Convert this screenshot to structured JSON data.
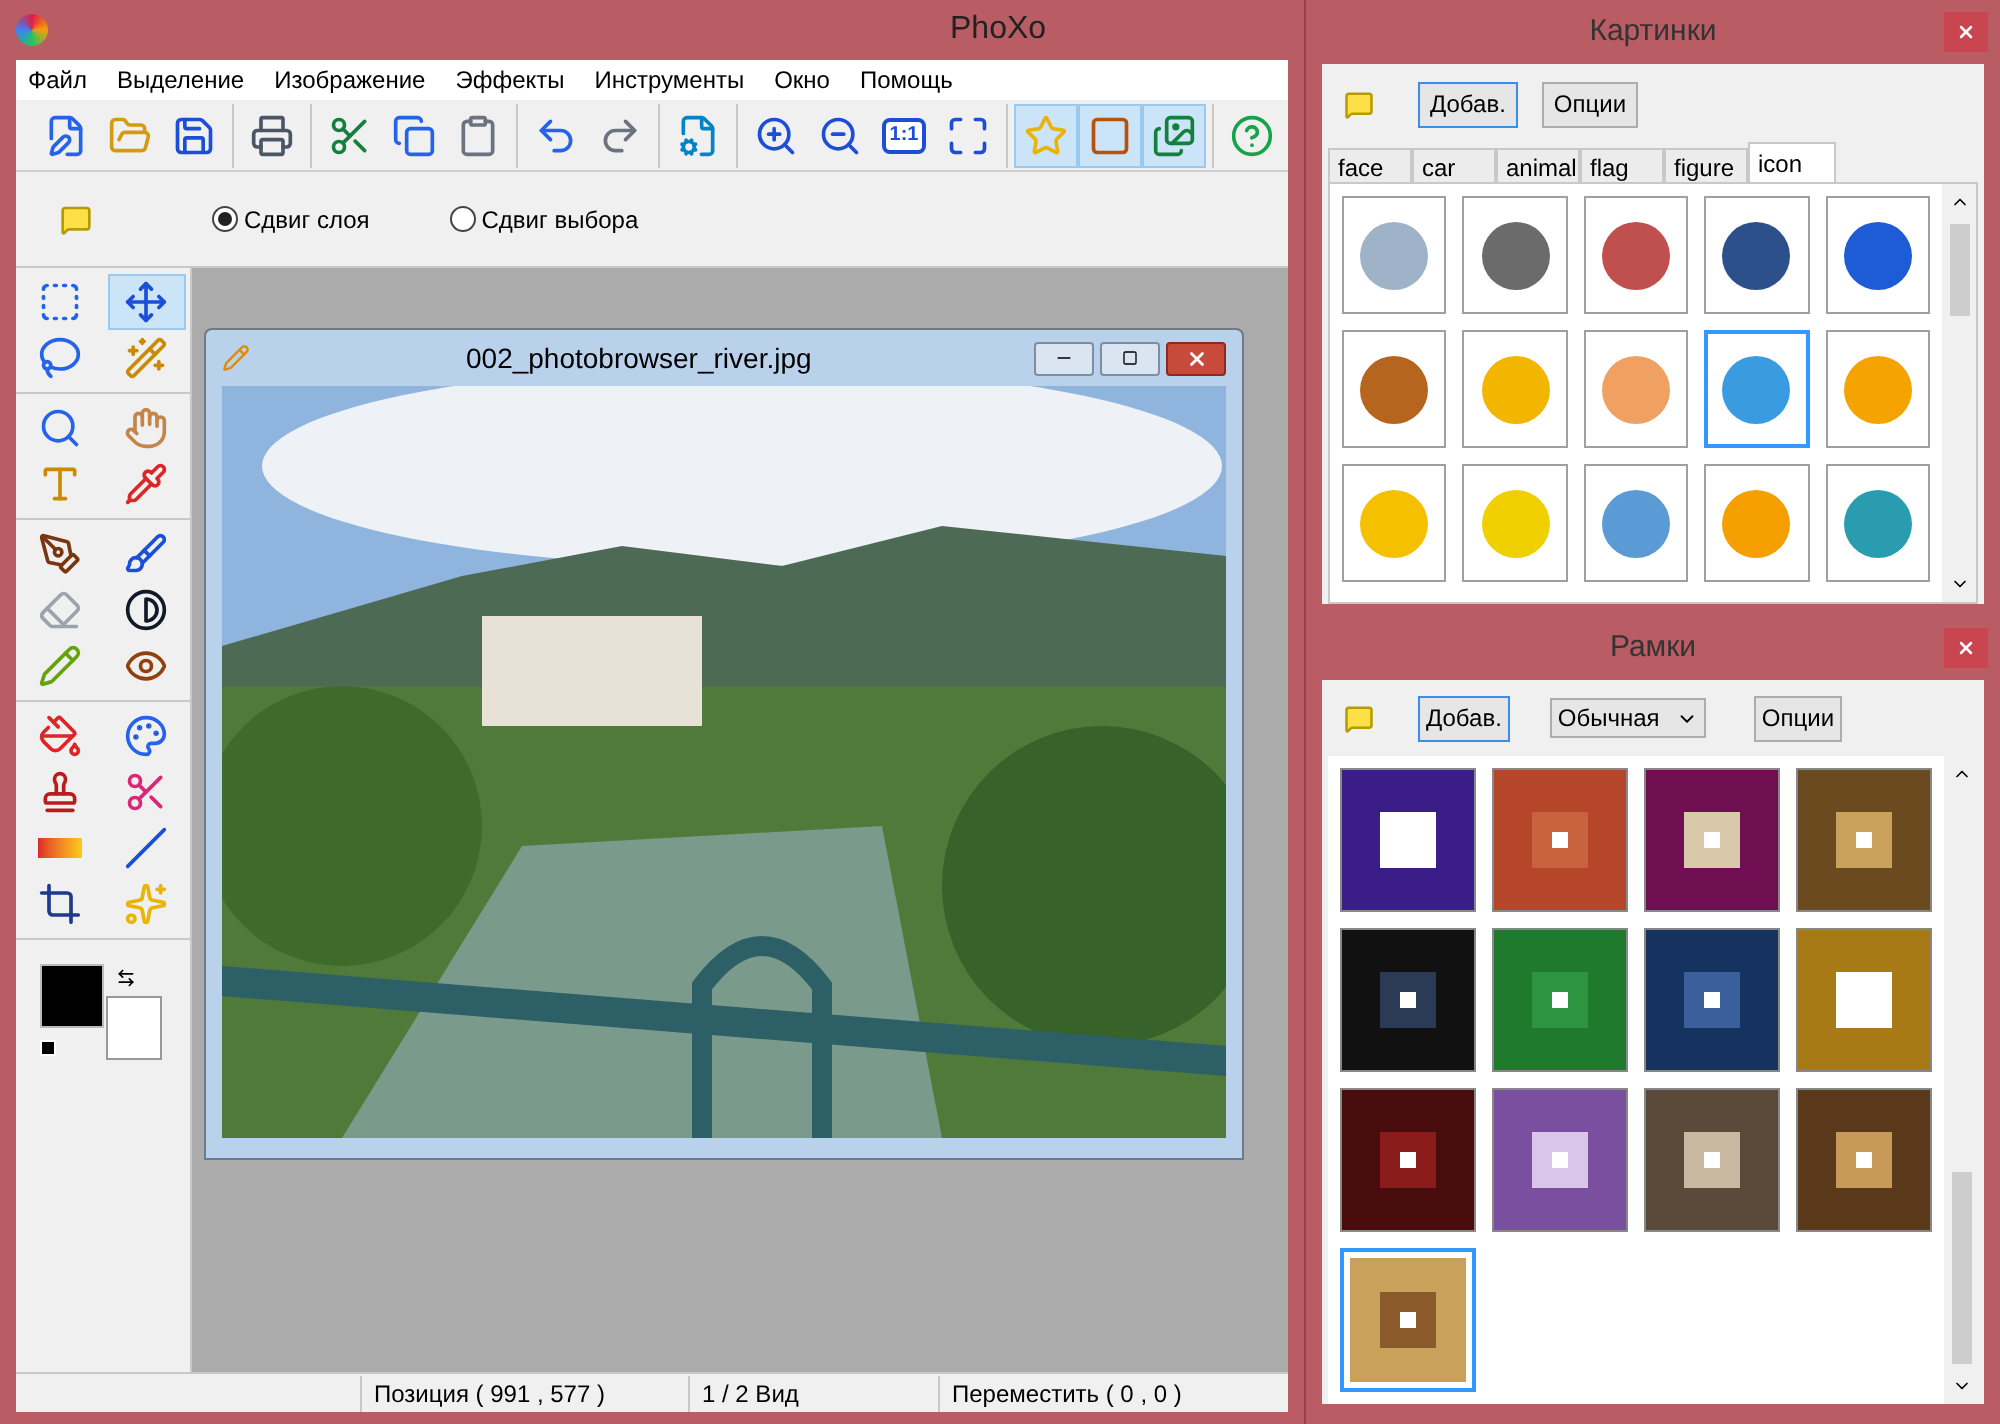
{
  "window": {
    "title": "PhoXo"
  },
  "menu": [
    "Файл",
    "Выделение",
    "Изображение",
    "Эффекты",
    "Инструменты",
    "Окно",
    "Помощь"
  ],
  "toolbar": [
    [
      {
        "kind": "new",
        "selected": false
      },
      {
        "kind": "open",
        "selected": false
      },
      {
        "kind": "save",
        "selected": false
      }
    ],
    [
      {
        "kind": "print",
        "selected": false
      }
    ],
    [
      {
        "kind": "cut",
        "selected": false
      },
      {
        "kind": "copy",
        "selected": false
      },
      {
        "kind": "paste",
        "selected": false
      }
    ],
    [
      {
        "kind": "undo",
        "selected": false
      },
      {
        "kind": "redo",
        "selected": false
      }
    ],
    [
      {
        "kind": "settings",
        "selected": false
      }
    ],
    [
      {
        "kind": "zoom-in",
        "selected": false
      },
      {
        "kind": "zoom-out",
        "selected": false
      },
      {
        "kind": "actual-size",
        "selected": false,
        "label": "1:1"
      },
      {
        "kind": "fit",
        "selected": false
      }
    ],
    [
      {
        "kind": "star",
        "selected": true
      },
      {
        "kind": "frame",
        "selected": true
      },
      {
        "kind": "pictures",
        "selected": true
      }
    ],
    [
      {
        "kind": "help",
        "selected": false
      }
    ]
  ],
  "options": [
    {
      "label": "Сдвиг слоя",
      "selected": true
    },
    {
      "label": "Сдвиг выбора",
      "selected": false
    }
  ],
  "tools": [
    [
      {
        "kind": "select-rect",
        "selected": false
      },
      {
        "kind": "move",
        "selected": true
      },
      {
        "kind": "lasso",
        "selected": false
      },
      {
        "kind": "wand",
        "selected": false
      }
    ],
    [
      {
        "kind": "zoom",
        "selected": false
      },
      {
        "kind": "hand",
        "selected": false
      },
      {
        "kind": "text",
        "selected": false
      },
      {
        "kind": "picker",
        "selected": false
      }
    ],
    [
      {
        "kind": "pen",
        "selected": false
      },
      {
        "kind": "brush",
        "selected": false
      },
      {
        "kind": "eraser",
        "selected": false
      },
      {
        "kind": "contrast",
        "selected": false
      },
      {
        "kind": "pencils",
        "selected": false
      },
      {
        "kind": "eye",
        "selected": false
      }
    ],
    [
      {
        "kind": "fill",
        "selected": false
      },
      {
        "kind": "palette",
        "selected": false
      },
      {
        "kind": "stamp",
        "selected": false
      },
      {
        "kind": "scissors",
        "selected": false
      },
      {
        "kind": "gradient",
        "selected": false
      },
      {
        "kind": "line",
        "selected": false
      },
      {
        "kind": "transform",
        "selected": false
      },
      {
        "kind": "stars",
        "selected": false
      }
    ]
  ],
  "image_window": {
    "title": "002_photobrowser_river.jpg"
  },
  "status_bar": [
    "Позиция ( 991 , 577 )",
    "1 / 2 Вид",
    "Переместить ( 0 , 0 )"
  ],
  "pictures_panel": {
    "title": "Картинки",
    "buttons": [
      {
        "label": "Добав.",
        "focused": true
      },
      {
        "label": "Опции",
        "focused": false
      }
    ],
    "tabs": [
      {
        "label": "face",
        "selected": false
      },
      {
        "label": "car",
        "selected": false
      },
      {
        "label": "animal",
        "selected": false
      },
      {
        "label": "flag",
        "selected": false
      },
      {
        "label": "figure",
        "selected": false
      },
      {
        "label": "icon",
        "selected": true
      }
    ],
    "items": [
      {
        "selected": false
      },
      {
        "selected": false
      },
      {
        "selected": false
      },
      {
        "selected": false
      },
      {
        "selected": false
      },
      {
        "selected": false
      },
      {
        "selected": false
      },
      {
        "selected": false
      },
      {
        "selected": true
      },
      {
        "selected": false
      },
      {
        "selected": false
      },
      {
        "selected": false
      },
      {
        "selected": false
      },
      {
        "selected": false
      },
      {
        "selected": false
      }
    ]
  },
  "frames_panel": {
    "title": "Рамки",
    "add_button": "Добав.",
    "style_select": "Обычная",
    "options_button": "Опции",
    "items": [
      {
        "selected": false
      },
      {
        "selected": false
      },
      {
        "selected": false
      },
      {
        "selected": false
      },
      {
        "selected": false
      },
      {
        "selected": false
      },
      {
        "selected": false
      },
      {
        "selected": false
      },
      {
        "selected": false
      },
      {
        "selected": false
      },
      {
        "selected": false
      },
      {
        "selected": false
      },
      {
        "selected": true
      }
    ]
  }
}
